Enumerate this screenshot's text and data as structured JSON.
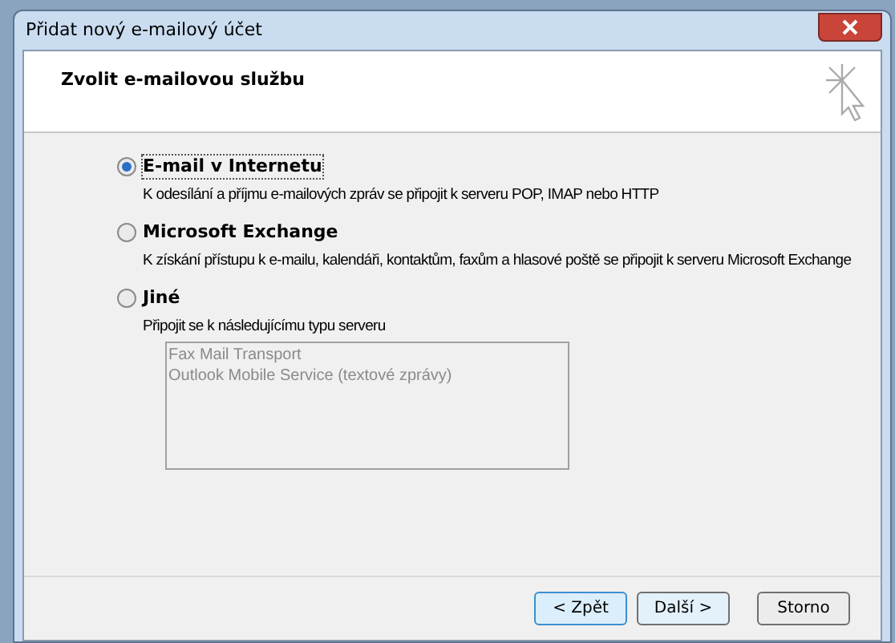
{
  "window": {
    "title": "Přidat nový e-mailový účet"
  },
  "header": {
    "title": "Zvolit e-mailovou službu"
  },
  "options": [
    {
      "label": "E-mail v Internetu",
      "description": "K odesílání a příjmu e-mailových zpráv se připojit k serveru POP, IMAP nebo HTTP",
      "selected": true
    },
    {
      "label": "Microsoft Exchange",
      "description": "K získání přístupu k e-mailu, kalendáři, kontaktům, faxům a hlasové poště se připojit k serveru Microsoft Exchange",
      "selected": false
    },
    {
      "label": "Jiné",
      "description": "Připojit se k následujícímu typu serveru",
      "selected": false
    }
  ],
  "server_list": {
    "disabled": true,
    "items": [
      "Fax Mail Transport",
      "Outlook Mobile Service (textové zprávy)"
    ]
  },
  "buttons": [
    {
      "label": "< Zpět",
      "focused": true
    },
    {
      "label": "Další >",
      "focused": false
    },
    {
      "label": "Storno",
      "focused": false
    }
  ]
}
